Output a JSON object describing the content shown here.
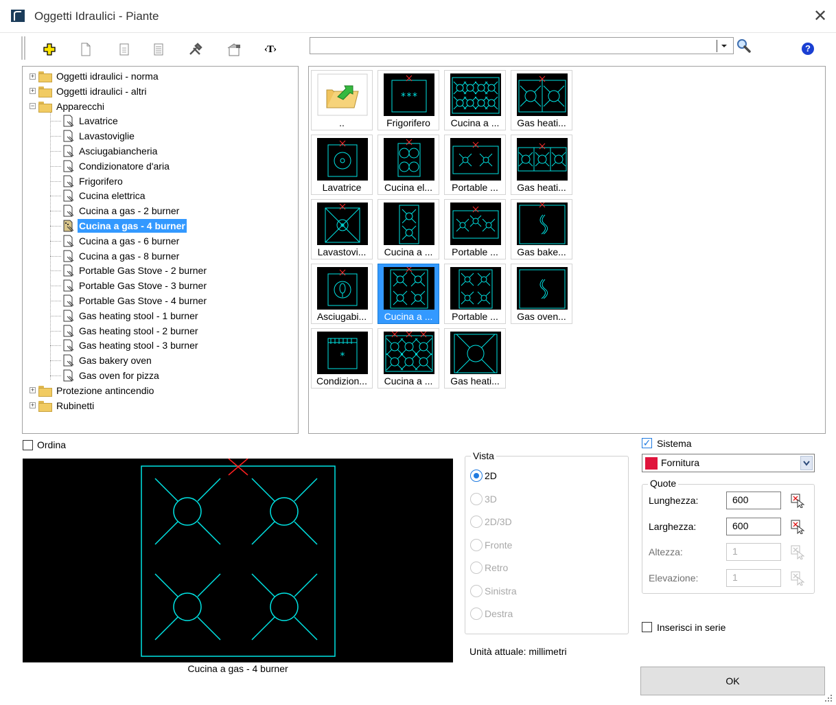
{
  "window": {
    "title": "Oggetti Idraulici - Piante",
    "close_glyph": "✕"
  },
  "toolbar": {
    "icons": [
      "add-icon",
      "new-document-icon",
      "document-list-icon",
      "document-lines-icon",
      "tools-icon",
      "building-icon",
      "text-tag-icon"
    ],
    "text_tag": "‹T›"
  },
  "search": {
    "value": "",
    "placeholder": ""
  },
  "help": {
    "glyph": "?"
  },
  "tree": {
    "items": [
      {
        "label": "Oggetti idraulici - norma",
        "kind": "folder",
        "expander": "+"
      },
      {
        "label": "Oggetti idraulici - altri",
        "kind": "folder",
        "expander": "+"
      },
      {
        "label": "Apparecchi",
        "kind": "folder",
        "expander": "−"
      },
      {
        "label": "Lavatrice",
        "kind": "item"
      },
      {
        "label": "Lavastoviglie",
        "kind": "item"
      },
      {
        "label": "Asciugabiancheria",
        "kind": "item"
      },
      {
        "label": "Condizionatore d'aria",
        "kind": "item"
      },
      {
        "label": "Frigorifero",
        "kind": "item"
      },
      {
        "label": "Cucina elettrica",
        "kind": "item"
      },
      {
        "label": "Cucina a gas - 2 burner",
        "kind": "item"
      },
      {
        "label": "Cucina a gas - 4 burner",
        "kind": "item",
        "selected": true
      },
      {
        "label": "Cucina a gas - 6 burner",
        "kind": "item"
      },
      {
        "label": "Cucina a gas - 8 burner",
        "kind": "item"
      },
      {
        "label": "Portable Gas Stove - 2 burner",
        "kind": "item"
      },
      {
        "label": "Portable Gas Stove - 3 burner",
        "kind": "item"
      },
      {
        "label": "Portable Gas Stove - 4 burner",
        "kind": "item"
      },
      {
        "label": "Gas heating stool - 1 burner",
        "kind": "item"
      },
      {
        "label": "Gas heating stool - 2 burner",
        "kind": "item"
      },
      {
        "label": "Gas heating stool - 3 burner",
        "kind": "item"
      },
      {
        "label": "Gas bakery oven",
        "kind": "item"
      },
      {
        "label": "Gas oven for pizza",
        "kind": "item"
      },
      {
        "label": "Protezione antincendio",
        "kind": "folder",
        "expander": "+"
      },
      {
        "label": "Rubinetti",
        "kind": "folder",
        "expander": "+"
      }
    ]
  },
  "grid": {
    "cells": [
      {
        "caption": "..",
        "thumb": "up-folder"
      },
      {
        "caption": "Frigorifero",
        "thumb": "fridge"
      },
      {
        "caption": "Cucina a ...",
        "thumb": "stove8"
      },
      {
        "caption": "Gas heati...",
        "thumb": "stool2"
      },
      {
        "caption": "Lavatrice",
        "thumb": "washer"
      },
      {
        "caption": "Cucina el...",
        "thumb": "electric"
      },
      {
        "caption": "Portable ...",
        "thumb": "portable2"
      },
      {
        "caption": "Gas heati...",
        "thumb": "stool3"
      },
      {
        "caption": "Lavastovi...",
        "thumb": "dishwasher"
      },
      {
        "caption": "Cucina a ...",
        "thumb": "stove2"
      },
      {
        "caption": "Portable ...",
        "thumb": "portable3"
      },
      {
        "caption": "Gas bake...",
        "thumb": "bakery"
      },
      {
        "caption": "Asciugabi...",
        "thumb": "dryer"
      },
      {
        "caption": "Cucina a ...",
        "thumb": "stove4",
        "selected": true
      },
      {
        "caption": "Portable ...",
        "thumb": "portable4"
      },
      {
        "caption": "Gas oven...",
        "thumb": "pizza"
      },
      {
        "caption": "Condizion...",
        "thumb": "aircon"
      },
      {
        "caption": "Cucina a ...",
        "thumb": "stove6"
      },
      {
        "caption": "Gas heati...",
        "thumb": "stool1"
      }
    ]
  },
  "ordina": {
    "label": "Ordina",
    "checked": false
  },
  "preview": {
    "caption": "Cucina a gas - 4 burner"
  },
  "vista": {
    "label": "Vista",
    "options": [
      {
        "label": "2D",
        "checked": true,
        "enabled": true
      },
      {
        "label": "3D",
        "checked": false,
        "enabled": false
      },
      {
        "label": "2D/3D",
        "checked": false,
        "enabled": false
      },
      {
        "label": "Fronte",
        "checked": false,
        "enabled": false
      },
      {
        "label": "Retro",
        "checked": false,
        "enabled": false
      },
      {
        "label": "Sinistra",
        "checked": false,
        "enabled": false
      },
      {
        "label": "Destra",
        "checked": false,
        "enabled": false
      }
    ]
  },
  "unita": "Unità attuale: millimetri",
  "sistema": {
    "label": "Sistema",
    "checked": true,
    "check_glyph": "✓",
    "value": "Fornitura",
    "color": "#e0143c"
  },
  "quote": {
    "label": "Quote",
    "fields": [
      {
        "label": "Lunghezza:",
        "value": "600",
        "enabled": true
      },
      {
        "label": "Larghezza:",
        "value": "600",
        "enabled": true
      },
      {
        "label": "Altezza:",
        "value": "1",
        "enabled": false
      },
      {
        "label": "Elevazione:",
        "value": "1",
        "enabled": false
      }
    ]
  },
  "serie": {
    "label": "Inserisci in serie",
    "checked": false
  },
  "ok": {
    "label": "OK"
  }
}
